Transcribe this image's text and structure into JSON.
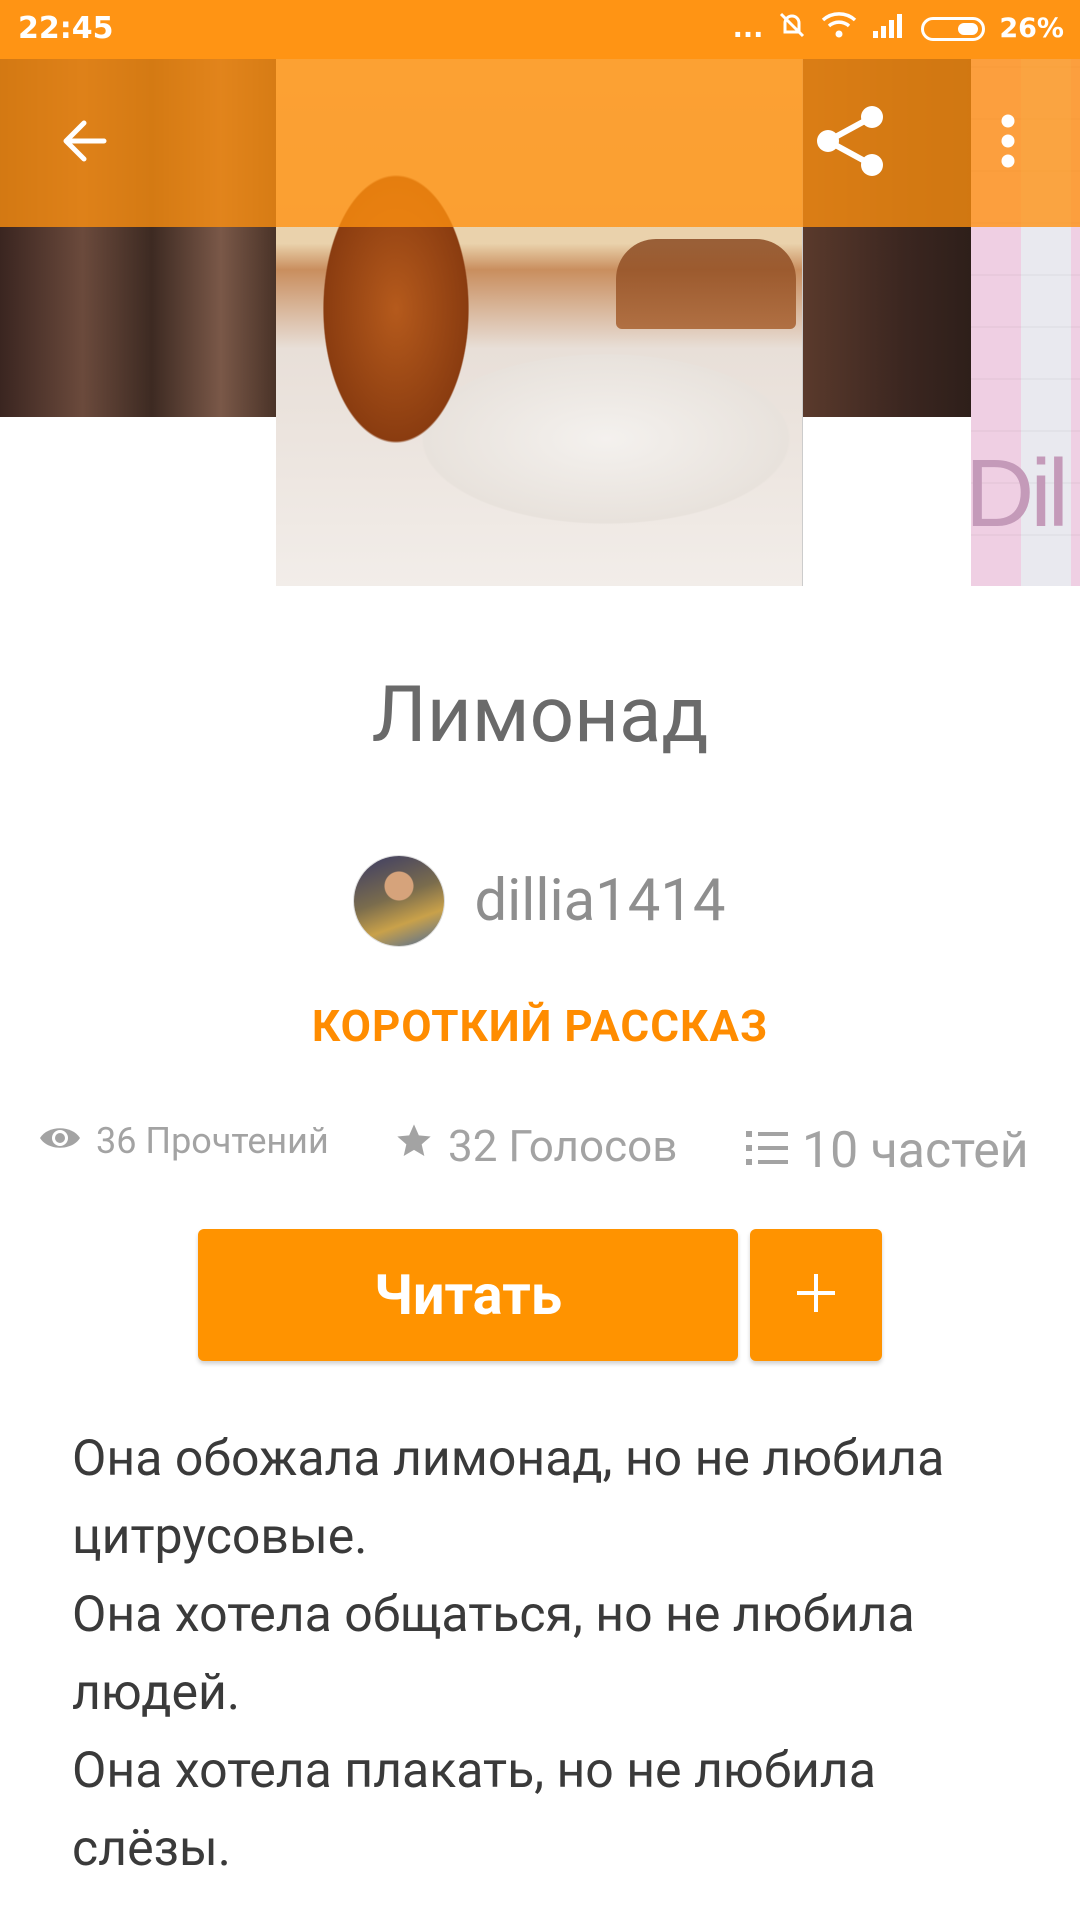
{
  "status_bar": {
    "time": "22:45",
    "dots": "...",
    "battery": "26%",
    "icons": [
      "mute-icon",
      "wifi-icon",
      "signal-icon",
      "battery-icon"
    ]
  },
  "app_bar": {
    "back_icon": "arrow-left-icon",
    "share_icon": "share-icon",
    "menu_icon": "more-vert-icon"
  },
  "cover": {
    "next_cover_text": "Dil"
  },
  "story": {
    "title": "Лимонад",
    "author": "dillia1414",
    "category": "КОРОТКИЙ РАССКАЗ",
    "stats": {
      "reads": "36 Прочтений",
      "votes": "32 Голосов",
      "parts": "10 частей"
    },
    "read_button": "Читать",
    "add_button": "+",
    "description": [
      "Она обожала лимонад, но не любила цитрусовые.",
      "Она хотела общаться, но не любила людей.",
      "Она хотела плакать, но не любила слёзы."
    ]
  },
  "colors": {
    "accent": "#ff9300",
    "status_bar": "#ff9414",
    "title_text": "#6a6a6a",
    "muted_text": "#a3a3a3"
  }
}
